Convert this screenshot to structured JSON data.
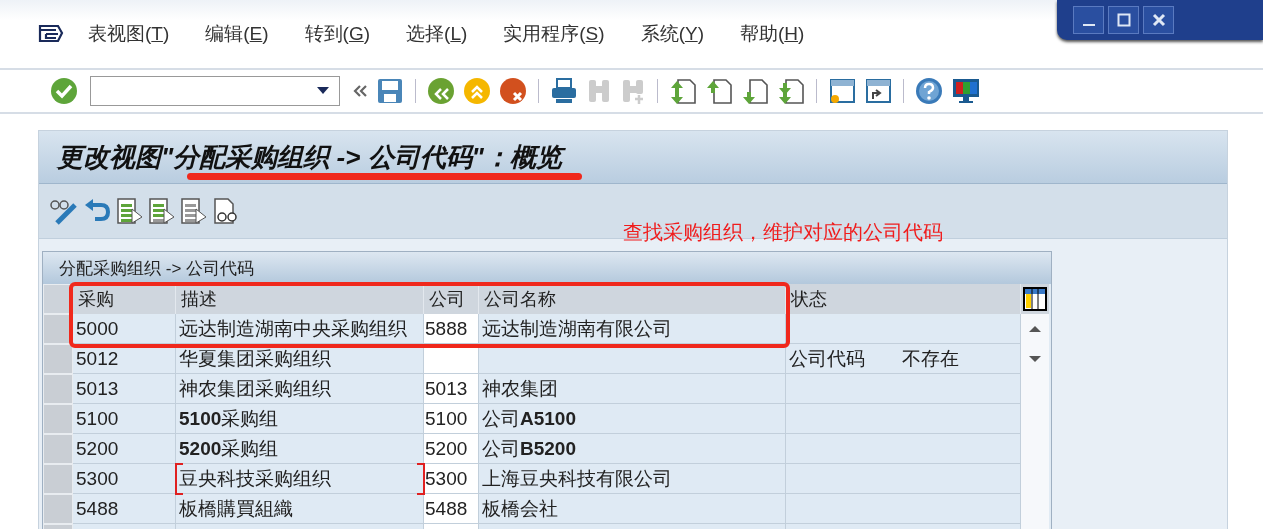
{
  "menu": [
    {
      "label": "表视图(T)"
    },
    {
      "label": "编辑(E)"
    },
    {
      "label": "转到(G)"
    },
    {
      "label": "选择(L)"
    },
    {
      "label": "实用程序(S)"
    },
    {
      "label": "系统(Y)"
    },
    {
      "label": "帮助(H)"
    }
  ],
  "screen_title": "更改视图\"分配采购组织 -> 公司代码\"：概览",
  "annotation": "查找采购组织，维护对应的公司代码",
  "table": {
    "caption": "分配采购组织 -> 公司代码",
    "columns": [
      "采购",
      "描述",
      "公司",
      "公司名称",
      "状态"
    ],
    "rows": [
      {
        "purch_org": "5000",
        "description": "远达制造湖南中央采购组织",
        "company": "5888",
        "company_name": "远达制造湖南有限公司",
        "status": ""
      },
      {
        "purch_org": "5012",
        "description": "华夏集团采购组织",
        "company": "",
        "company_name": "",
        "status": "公司代码       不存在"
      },
      {
        "purch_org": "5013",
        "description": "神农集团采购组织",
        "company": "5013",
        "company_name": "神农集团",
        "status": ""
      },
      {
        "purch_org": "5100",
        "description": "**5100**采购组",
        "company": "5100",
        "company_name": "公司**A5100**",
        "status": ""
      },
      {
        "purch_org": "5200",
        "description": "**5200**采购组",
        "company": "5200",
        "company_name": "公司**B5200**",
        "status": ""
      },
      {
        "purch_org": "5300",
        "description": "豆央科技采购组织",
        "company": "5300",
        "company_name": "上海豆央科技有限公司",
        "status": ""
      },
      {
        "purch_org": "5488",
        "description": "板橋購買組織",
        "company": "5488",
        "company_name": "板橋会社",
        "status": ""
      }
    ]
  }
}
